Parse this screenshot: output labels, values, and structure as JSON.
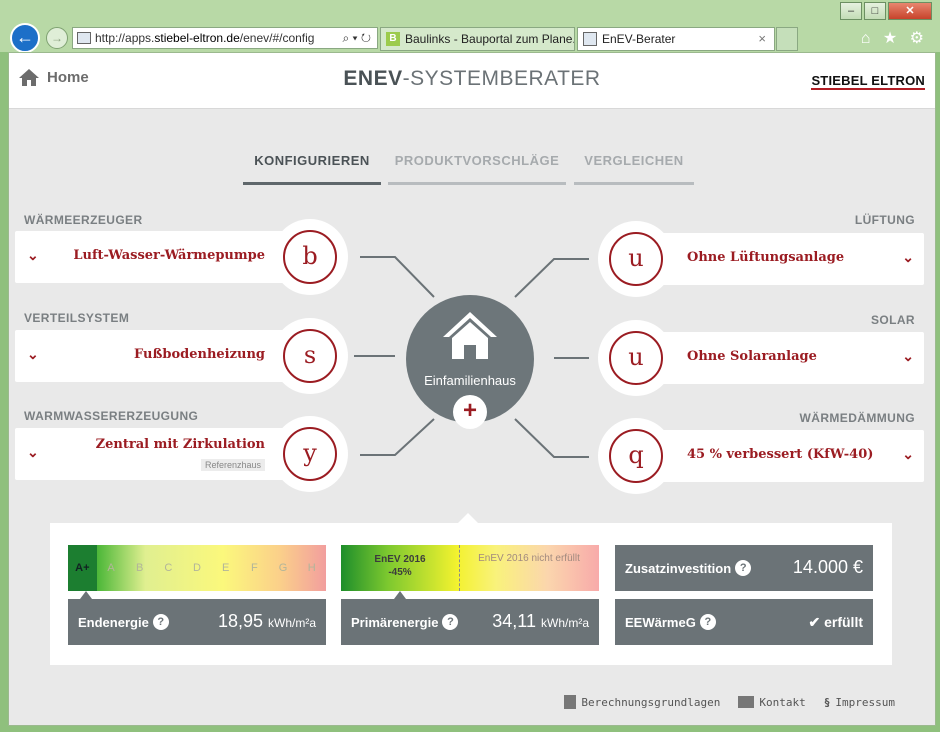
{
  "browser": {
    "url_prefix": "http://apps.",
    "url_host": "stiebel-eltron.de",
    "url_path": "/enev/#/config",
    "url_tools": "⌕ ▾ ↻",
    "tabs": [
      {
        "label": "Baulinks - Bauportal zum Plane..."
      },
      {
        "label": "EnEV-Berater",
        "close": "×"
      }
    ],
    "window_controls": {
      "minimize": "–",
      "maximize": "□",
      "close": "✕"
    },
    "toolbar_icons": "⌂ ★ ⚙"
  },
  "header": {
    "home_label": "Home",
    "title_bold": "ENEV",
    "title_rest": "-SYSTEMBERATER",
    "brand": "STIEBEL ELTRON"
  },
  "steps": [
    {
      "label": "KONFIGURIEREN"
    },
    {
      "label": "PRODUKTVORSCHLÄGE"
    },
    {
      "label": "VERGLEICHEN"
    }
  ],
  "config": {
    "left": [
      {
        "category": "WÄRMEERZEUGER",
        "value": "Luft-Wasser-Wärmepumpe",
        "icon_letter": "b"
      },
      {
        "category": "VERTEILSYSTEM",
        "value": "Fußbodenheizung",
        "icon_letter": "s"
      },
      {
        "category": "WARMWASSERERZEUGUNG",
        "value": "Zentral mit Zirkulation",
        "badge": "Referenzhaus",
        "icon_letter": "y"
      }
    ],
    "right": [
      {
        "category": "LÜFTUNG",
        "value": "Ohne Lüftungsanlage",
        "icon_letter": "u"
      },
      {
        "category": "SOLAR",
        "value": "Ohne Solaranlage",
        "icon_letter": "u"
      },
      {
        "category": "WÄRMEDÄMMUNG",
        "value": "45 % verbessert (KfW-40)",
        "icon_letter": "q"
      }
    ],
    "center_label": "Einfamilienhaus",
    "add_symbol": "+"
  },
  "results": {
    "efficiency_classes": [
      "A+",
      "A",
      "B",
      "C",
      "D",
      "E",
      "F",
      "G",
      "H"
    ],
    "endenergie": {
      "label": "Endenergie",
      "value": "18,95",
      "unit": "kWh/m²a"
    },
    "enev_fulfilled": "EnEV 2016",
    "enev_fulfilled_pct": "-45%",
    "enev_not_fulfilled": "EnEV 2016 nicht erfüllt",
    "primaerenergie": {
      "label": "Primärenergie",
      "value": "34,11",
      "unit": "kWh/m²a"
    },
    "zusatz": {
      "label": "Zusatzinvestition",
      "value": "14.000 €"
    },
    "eewaerme": {
      "label": "EEWärmeG",
      "value": "✔ erfüllt"
    },
    "help_symbol": "?"
  },
  "footer": {
    "calc": "Berechnungsgrundlagen",
    "contact": "Kontakt",
    "imprint": "Impressum"
  },
  "colors": {
    "accent": "#9b1c22",
    "panel": "#6b7377"
  }
}
